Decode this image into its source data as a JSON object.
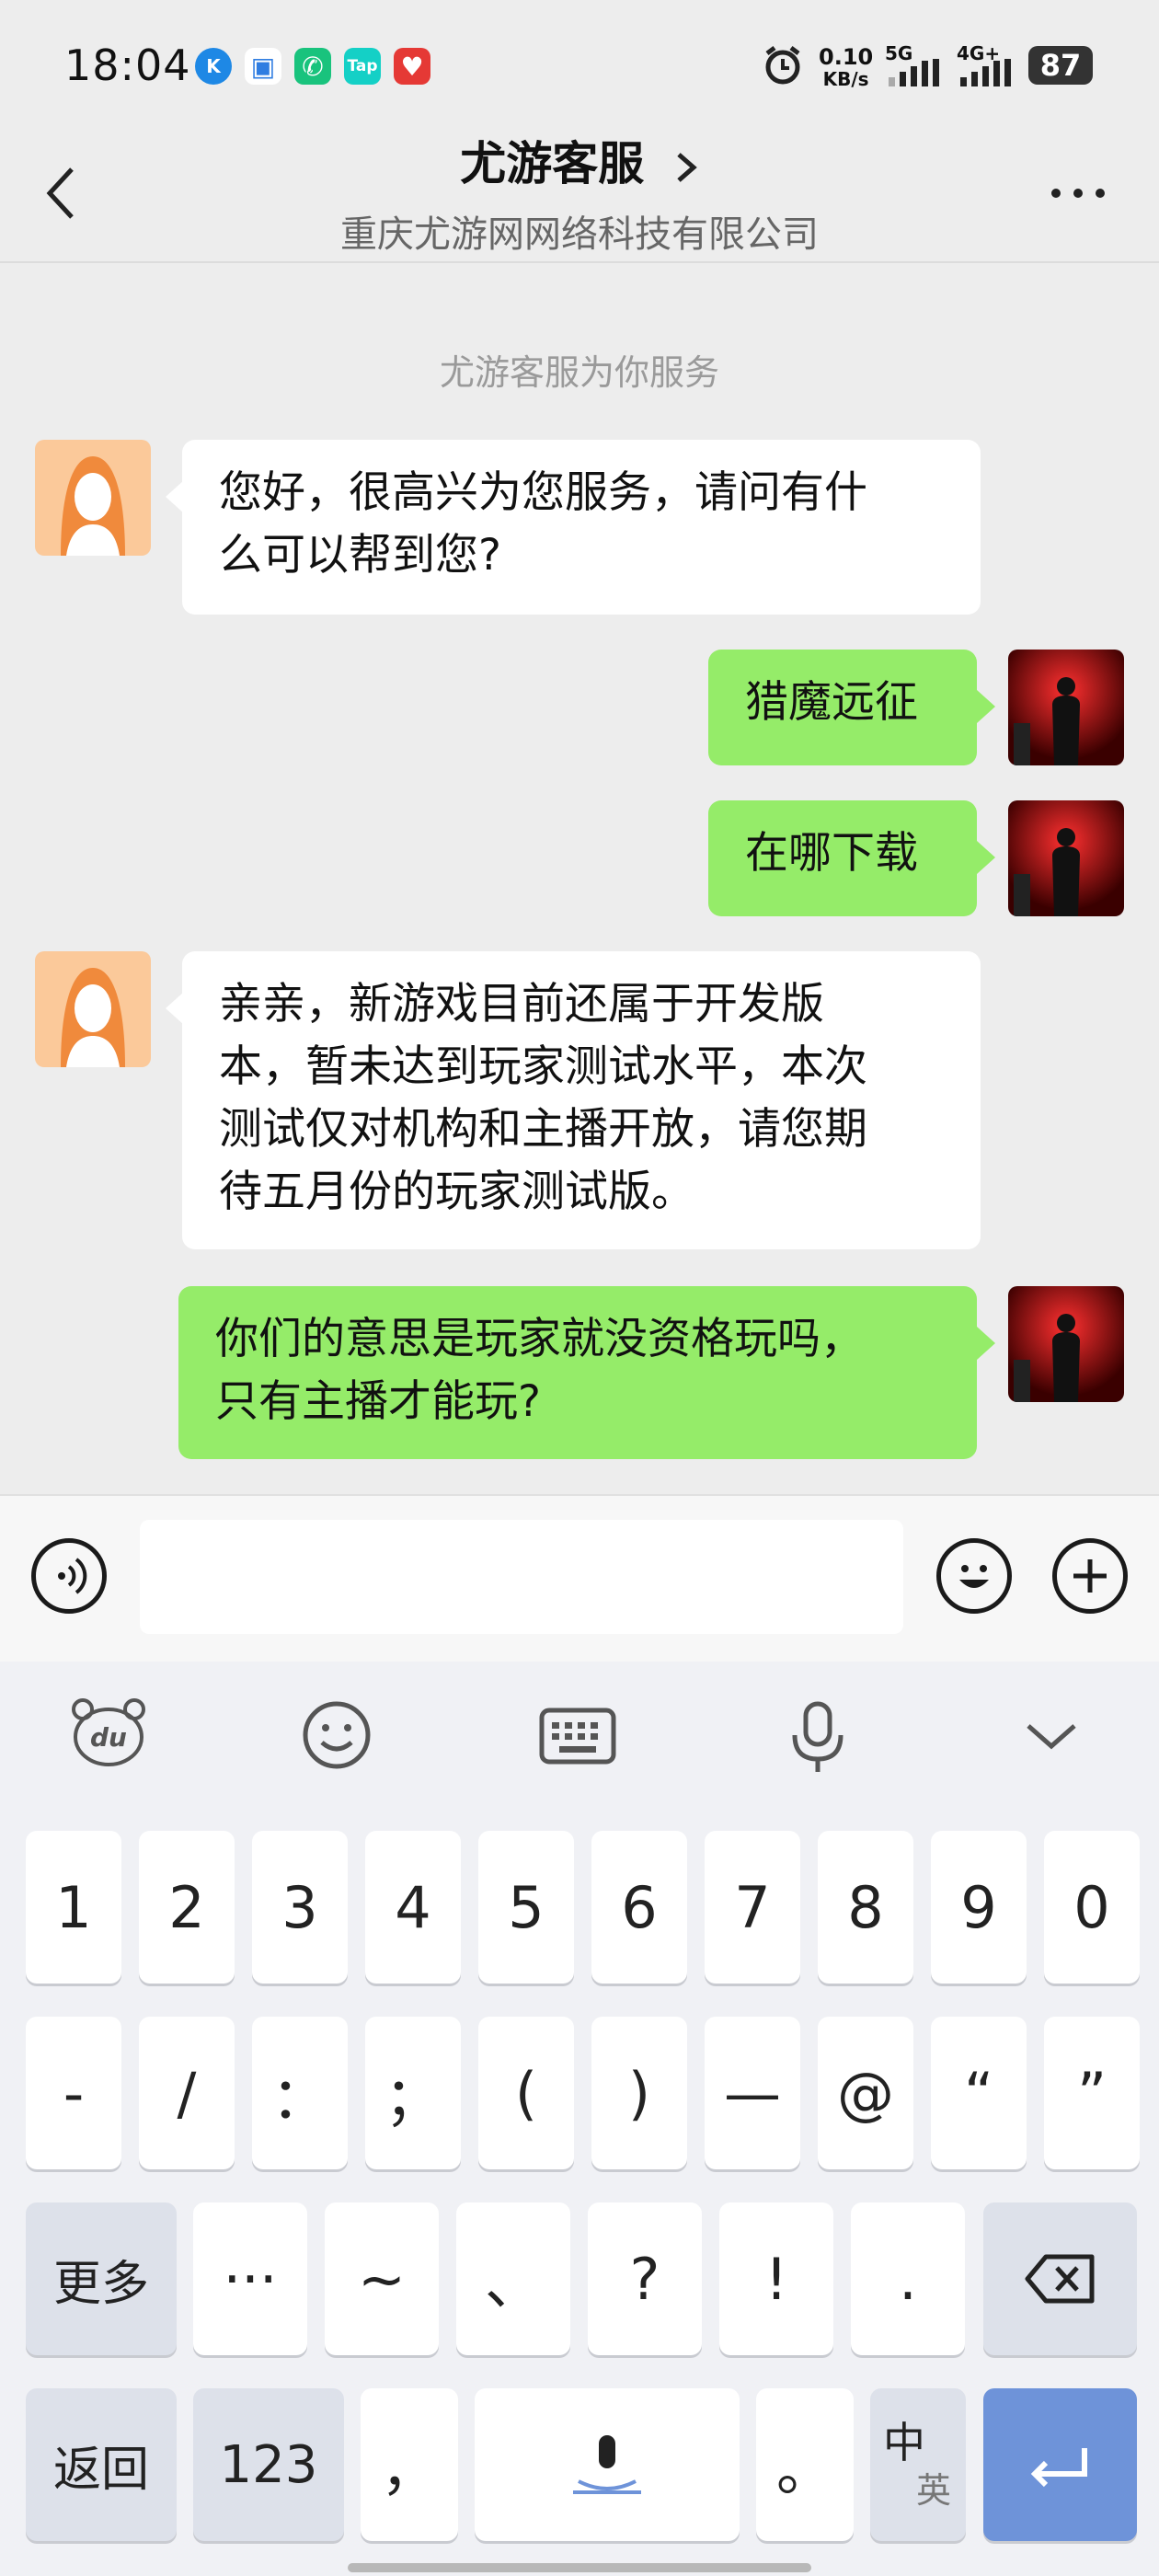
{
  "status_bar": {
    "time": "18:04",
    "net_speed_value": "0.10",
    "net_speed_unit": "KB/s",
    "signal1": "5G",
    "signal2": "4G+",
    "battery": "87",
    "app_icons": [
      {
        "name": "k-app-icon",
        "glyph": "K",
        "color": "#1e88e5"
      },
      {
        "name": "cloud-app-icon",
        "glyph": "▣",
        "color": "#2f7de1"
      },
      {
        "name": "phone-app-icon",
        "glyph": "✆",
        "color": "#19c37d"
      },
      {
        "name": "tap-app-icon",
        "glyph": "Tap",
        "color": "#14d0c6"
      },
      {
        "name": "heart-app-icon",
        "glyph": "♥",
        "color": "#e53935"
      }
    ]
  },
  "header": {
    "title": "尤游客服",
    "subtitle": "重庆尤游网网络科技有限公司"
  },
  "chat": {
    "system_message": "尤游客服为你服务",
    "messages": [
      {
        "side": "left",
        "lines": [
          "您好，很高兴为您服务，请问有什",
          "么可以帮到您?"
        ]
      },
      {
        "side": "right",
        "lines": [
          "猎魔远征"
        ]
      },
      {
        "side": "right",
        "lines": [
          "在哪下载"
        ]
      },
      {
        "side": "left",
        "lines": [
          "亲亲，新游戏目前还属于开发版",
          "本，暂未达到玩家测试水平，本次",
          "测试仅对机构和主播开放，请您期",
          "待五月份的玩家测试版。"
        ]
      },
      {
        "side": "right",
        "lines": [
          "你们的意思是玩家就没资格玩吗，",
          "只有主播才能玩?"
        ]
      }
    ]
  },
  "input": {
    "value": "",
    "placeholder": ""
  },
  "keyboard": {
    "toolbar": [
      "bear-du-icon",
      "emoji-face-icon",
      "keyboard-icon",
      "microphone-icon",
      "collapse-chevron-icon"
    ],
    "bear_label": "du",
    "row1": [
      "1",
      "2",
      "3",
      "4",
      "5",
      "6",
      "7",
      "8",
      "9",
      "0"
    ],
    "row2": [
      "-",
      "/",
      "：",
      "；",
      "(",
      ")",
      "—",
      "@",
      "“",
      "”"
    ],
    "row3": [
      "更多",
      "···",
      "~",
      "、",
      "?",
      "!",
      "."
    ],
    "row4": {
      "back": "返回",
      "num": "123",
      "comma": "，",
      "period": "。",
      "lang_top": "中",
      "lang_bottom": "英"
    }
  }
}
